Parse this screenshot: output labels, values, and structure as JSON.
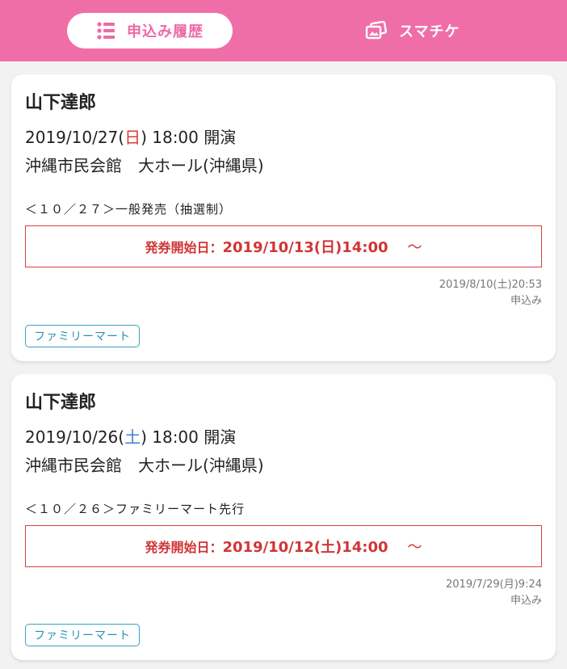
{
  "header": {
    "tabs": [
      {
        "label": "申込み履歴",
        "icon": "list-icon",
        "active": true
      },
      {
        "label": "スマチケ",
        "icon": "smart-ticket-icon",
        "active": false
      }
    ]
  },
  "colors": {
    "brand": "#f06ea7",
    "alert": "#d03535",
    "sunday": "#d83a3a",
    "saturday": "#3f7fcc",
    "link": "#2a92b4"
  },
  "applications": [
    {
      "artist": "山下達郎",
      "date_pre": "2019/10/27(",
      "dow": "日",
      "date_post": ") 18:00 開演",
      "venue": "沖縄市民会館　大ホール(沖縄県)",
      "sale_type": "＜１０／２７＞一般発売（抽選制）",
      "ticket_label": "発券開始日：",
      "ticket_date": "2019/10/13(日)14:00",
      "ticket_tilde": "～",
      "applied_at": "2019/8/10(土)20:53",
      "applied_label": "申込み",
      "store": "ファミリーマート"
    },
    {
      "artist": "山下達郎",
      "date_pre": "2019/10/26(",
      "dow": "土",
      "date_post": ") 18:00 開演",
      "venue": "沖縄市民会館　大ホール(沖縄県)",
      "sale_type": "＜１０／２６＞ファミリーマート先行",
      "ticket_label": "発券開始日：",
      "ticket_date": "2019/10/12(土)14:00",
      "ticket_tilde": "～",
      "applied_at": "2019/7/29(月)9:24",
      "applied_label": "申込み",
      "store": "ファミリーマート"
    }
  ]
}
